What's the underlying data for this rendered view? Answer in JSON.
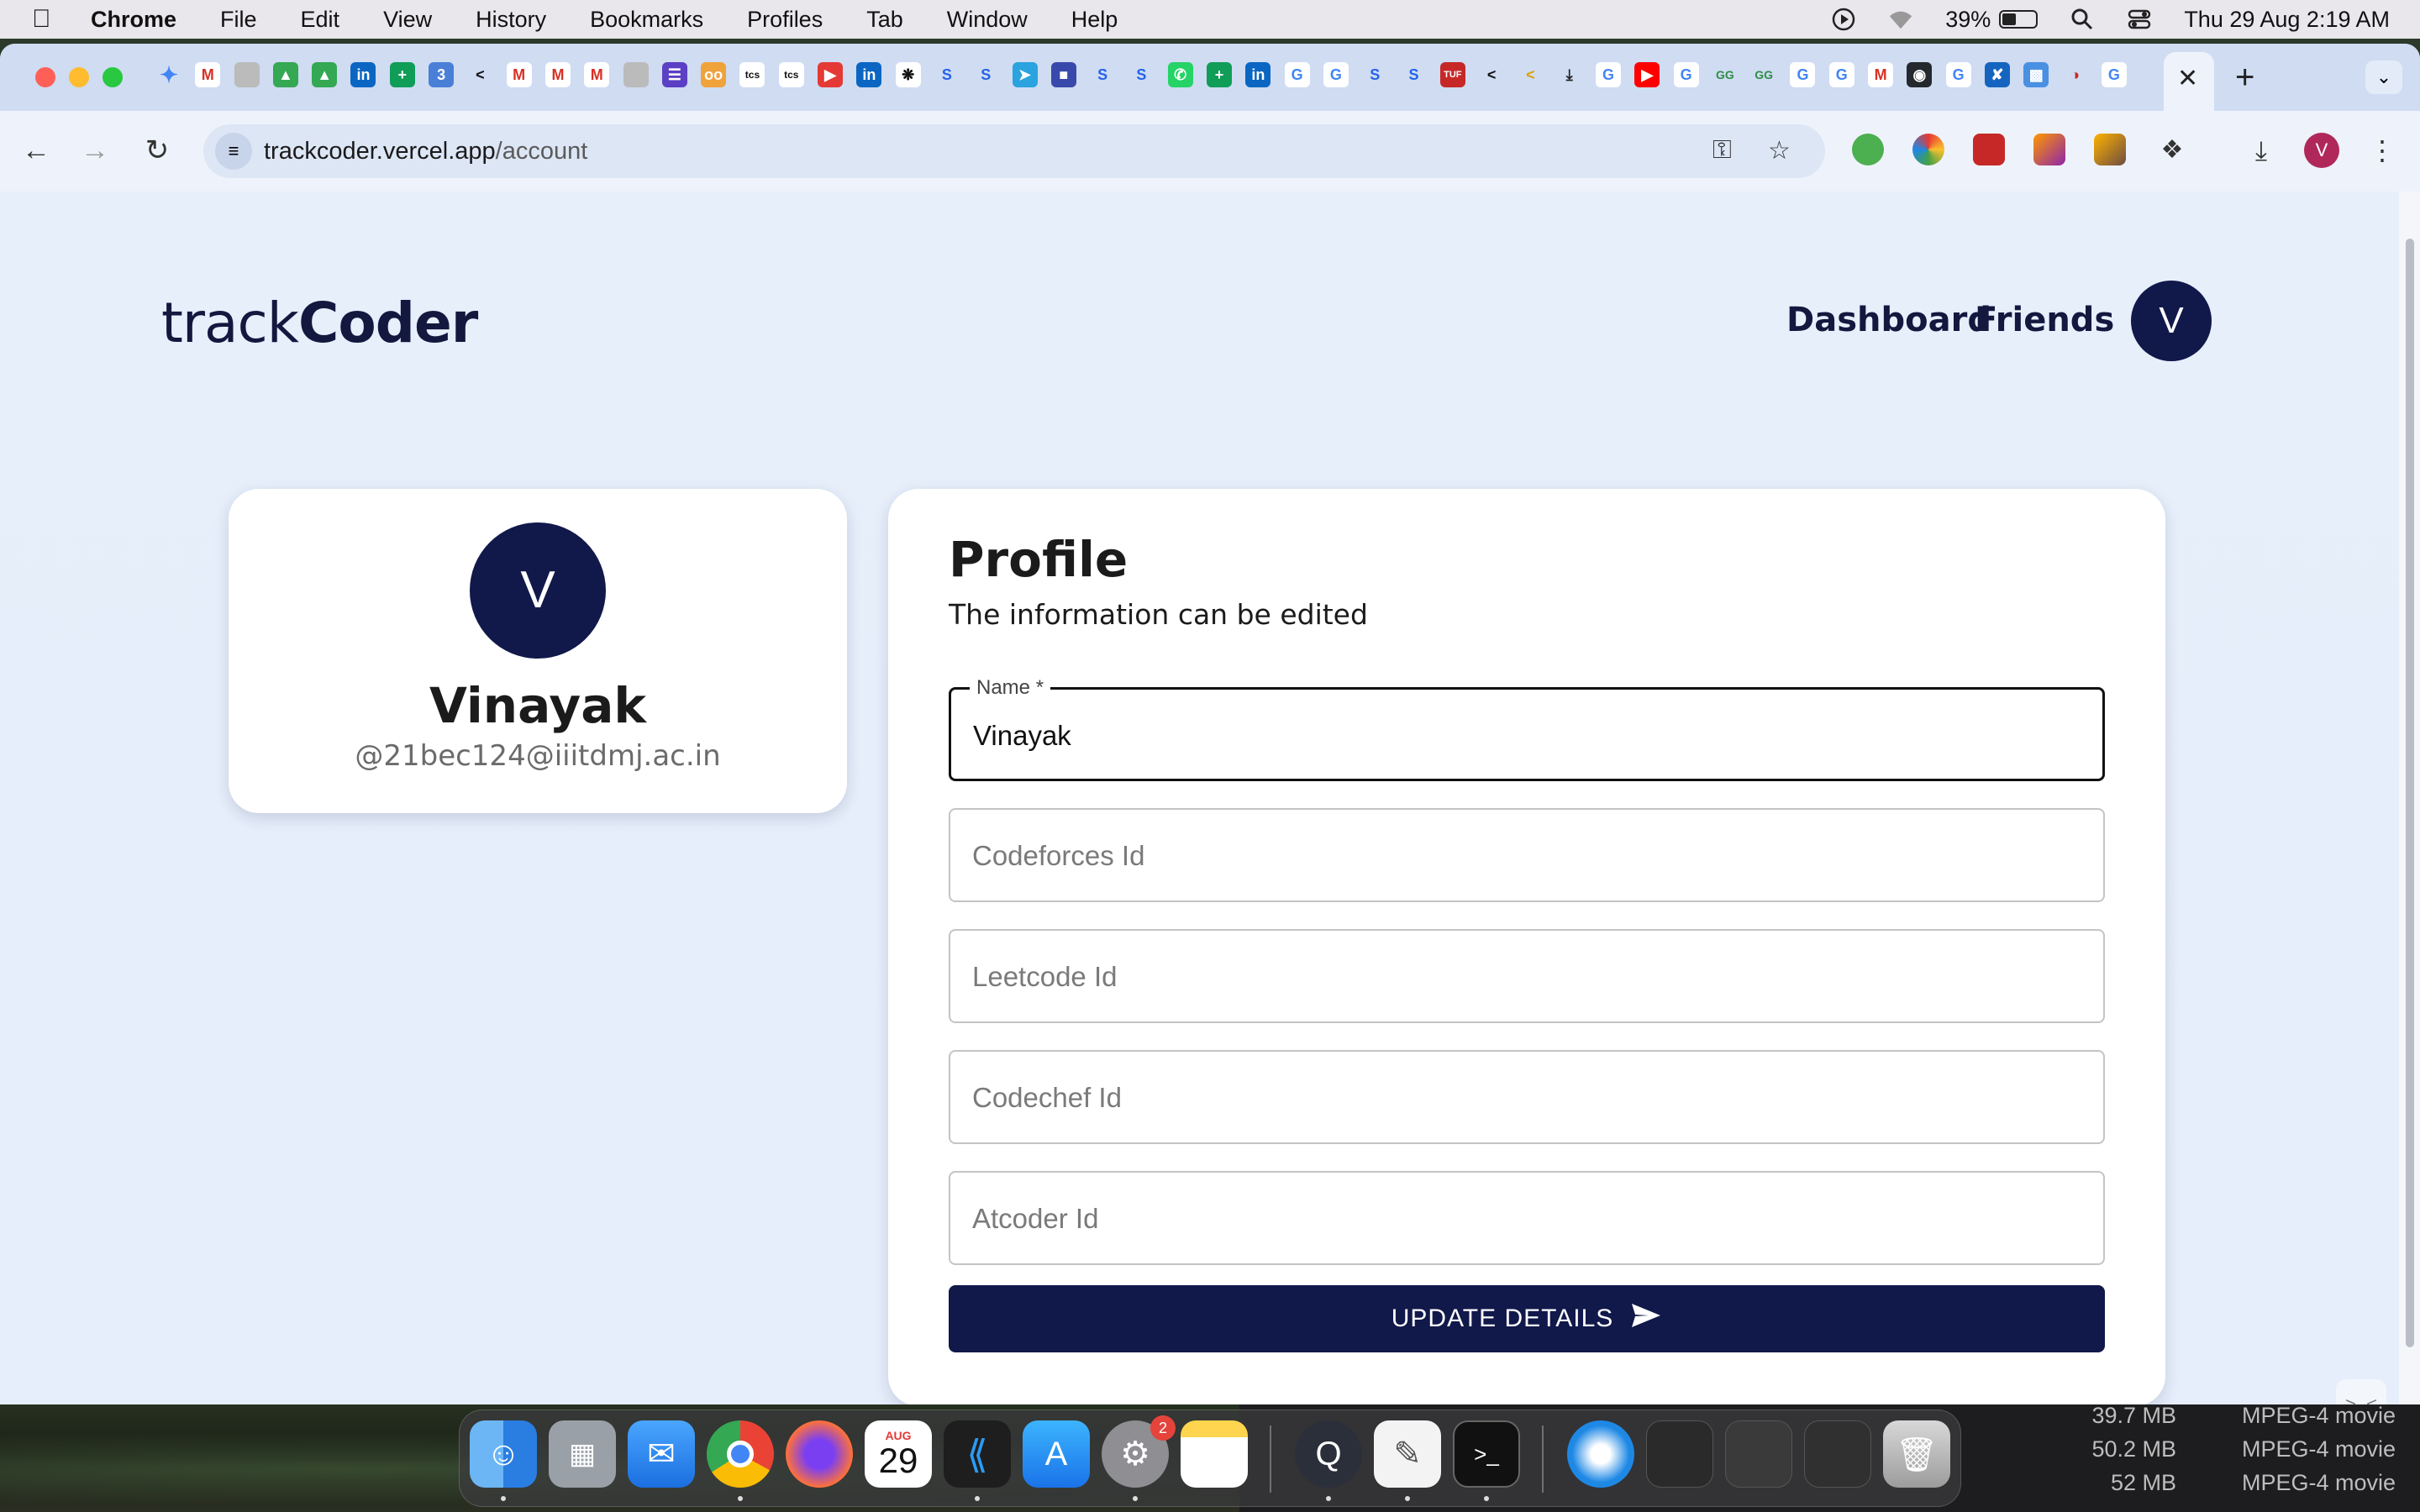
{
  "menubar": {
    "app_name": "Chrome",
    "menus": [
      "File",
      "Edit",
      "View",
      "History",
      "Bookmarks",
      "Profiles",
      "Tab",
      "Window",
      "Help"
    ],
    "battery_percent": "39%",
    "datetime": "Thu 29 Aug  2:19 AM"
  },
  "browser": {
    "url_host": "trackcoder.vercel.app",
    "url_path": "/account",
    "profile_initial": "V"
  },
  "site": {
    "logo_light": "track",
    "logo_bold": "Coder",
    "nav": {
      "dashboard": "Dashboard",
      "friends": "Friends"
    },
    "avatar_initial": "V"
  },
  "user_card": {
    "avatar_initial": "V",
    "name": "Vinayak",
    "handle": "@21bec124@iiitdmj.ac.in"
  },
  "profile": {
    "title": "Profile",
    "subtitle": "The information can be edited",
    "fields": {
      "name": {
        "label": "Name *",
        "value": "Vinayak"
      },
      "codeforces": {
        "placeholder": "Codeforces Id"
      },
      "leetcode": {
        "placeholder": "Leetcode Id"
      },
      "codechef": {
        "placeholder": "Codechef Id"
      },
      "atcoder": {
        "placeholder": "Atcoder Id"
      }
    },
    "submit_label": "UPDATE DETAILS"
  },
  "dock": {
    "calendar_month": "AUG",
    "calendar_day": "29",
    "settings_badge": "2"
  },
  "finder": {
    "rows": [
      {
        "size": "39.7 MB",
        "kind": "MPEG-4 movie"
      },
      {
        "size": "50.2 MB",
        "kind": "MPEG-4 movie"
      },
      {
        "size": "52 MB",
        "kind": "MPEG-4 movie"
      }
    ]
  },
  "colors": {
    "brand_navy": "#11184a",
    "page_bg": "#e7effb"
  }
}
